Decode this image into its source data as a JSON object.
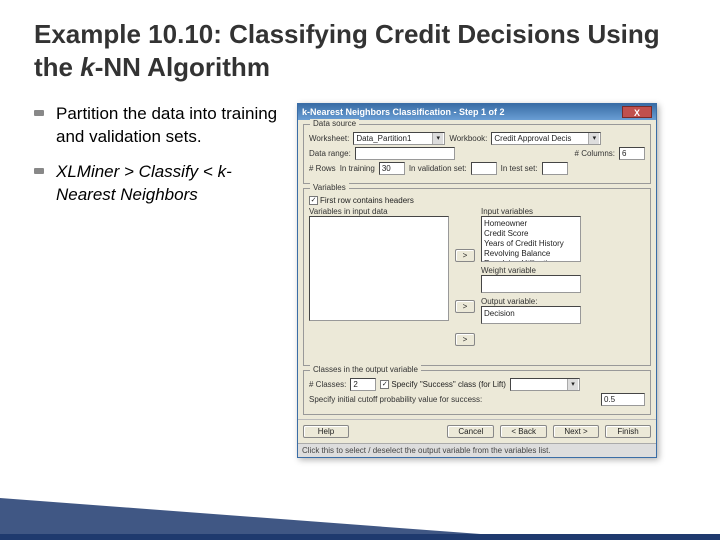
{
  "title": {
    "prefix": "Example 10.10: Classifying Credit Decisions Using the ",
    "ital": "k",
    "suffix": "-NN Algorithm"
  },
  "bullets": {
    "b1": "Partition the data into training and validation sets.",
    "b2_pre": "XLMiner > Classify < ",
    "b2_ital": "k-Nearest Neighbors"
  },
  "dialog": {
    "title": "k-Nearest Neighbors Classification - Step 1 of 2",
    "close": "X",
    "data_source": {
      "legend": "Data source",
      "worksheet_label": "Worksheet:",
      "worksheet_value": "Data_Partition1",
      "workbook_label": "Workbook:",
      "workbook_value": "Credit Approval Decis",
      "range_label": "Data range:",
      "range_value": "",
      "cols_label": "# Columns:",
      "cols_value": "6",
      "rows_label": "# Rows",
      "training_label": "In training",
      "training_value": "30",
      "validation_label": "In validation set:",
      "validation_value": "",
      "test_label": "In test set:",
      "test_value": ""
    },
    "variables": {
      "legend": "Variables",
      "firstrow_label": "First row contains headers",
      "left_label": "Variables in input data",
      "input_label": "Input variables",
      "input_items": [
        "Homeowner",
        "Credit Score",
        "Years of Credit History",
        "Revolving Balance",
        "Revolving Utilization"
      ],
      "move_in": ">",
      "weight_label": "Weight variable",
      "move_w": ">",
      "output_label": "Output variable:",
      "output_value": "Decision",
      "move_o": ">"
    },
    "classes": {
      "legend": "Classes in the output variable",
      "n_label": "# Classes:",
      "n_value": "2",
      "success_label": "Specify \"Success\" class (for Lift)",
      "cutoff_label": "Specify initial cutoff probability value for success:",
      "cutoff_value": "0.5"
    },
    "buttons": {
      "help": "Help",
      "cancel": "Cancel",
      "back": "< Back",
      "next": "Next >",
      "finish": "Finish"
    },
    "hint": "Click this to select / deselect the output variable from the variables list."
  }
}
